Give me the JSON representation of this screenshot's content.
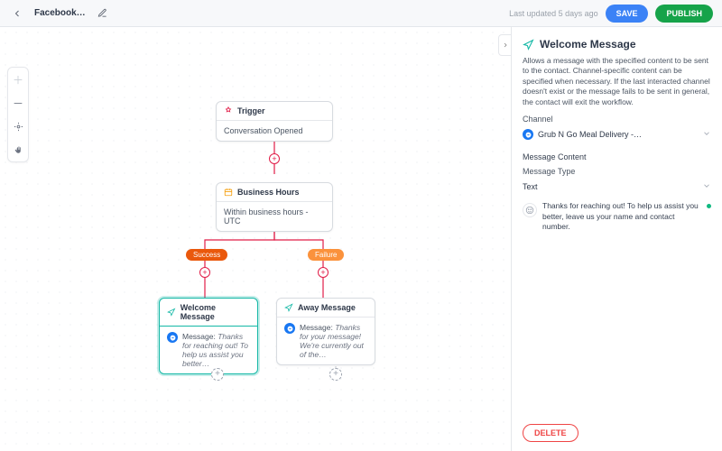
{
  "header": {
    "title": "Facebook…",
    "last_updated": "Last updated 5 days ago",
    "save_label": "SAVE",
    "publish_label": "PUBLISH"
  },
  "nodes": {
    "trigger": {
      "title": "Trigger",
      "body": "Conversation Opened"
    },
    "business_hours": {
      "title": "Business Hours",
      "body": "Within business hours - UTC"
    },
    "welcome": {
      "title": "Welcome Message",
      "prefix": "Message:",
      "preview": "Thanks for reaching out! To help us assist you better…"
    },
    "away": {
      "title": "Away Message",
      "prefix": "Message:",
      "preview": "Thanks for your message! We're currently out of the…"
    }
  },
  "branches": {
    "success": "Success",
    "failure": "Failure"
  },
  "panel": {
    "title": "Welcome Message",
    "description": "Allows a message with the specified content to be sent to the contact. Channel-specific content can be specified when necessary. If the last interacted channel doesn't exist or the message fails to be sent in general, the contact will exit the workflow.",
    "channel_label": "Channel",
    "channel_value": "Grub N Go Meal Delivery -…",
    "content_label": "Message Content",
    "type_label": "Message Type",
    "type_value": "Text",
    "message_text": "Thanks for reaching out! To help us assist you better, leave us your name and contact number.",
    "delete_label": "DELETE"
  }
}
